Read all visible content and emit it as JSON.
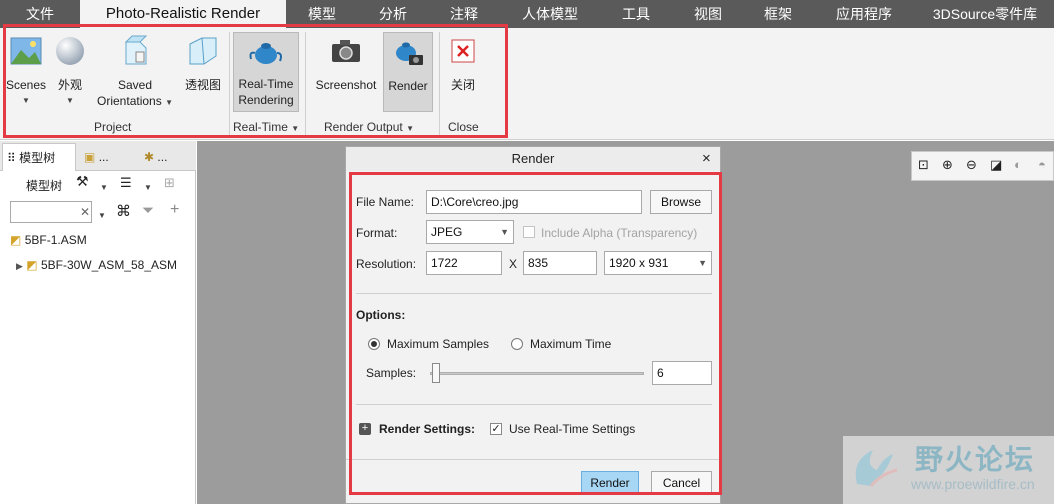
{
  "tabs": [
    "文件",
    "Photo-Realistic Render",
    "模型",
    "分析",
    "注释",
    "人体模型",
    "工具",
    "视图",
    "框架",
    "应用程序",
    "3DSource零件库"
  ],
  "ribbon": {
    "scenes": "Scenes",
    "appearance": "外观",
    "saved_orientations_line1": "Saved",
    "saved_orientations_line2": "Orientations",
    "perspective": "透视图",
    "realtime_line1": "Real-Time",
    "realtime_line2": "Rendering",
    "screenshot": "Screenshot",
    "render": "Render",
    "close": "关闭",
    "groups": {
      "project": "Project",
      "realtime": "Real-Time",
      "render_output": "Render Output",
      "close": "Close"
    }
  },
  "leftpanel": {
    "tabs": [
      "模型树",
      "...",
      "..."
    ],
    "toolbar_label": "模型树",
    "search_placeholder": "",
    "tree": [
      {
        "label": "5BF-1.ASM"
      },
      {
        "label": "5BF-30W_ASM_58_ASM"
      }
    ]
  },
  "dialog": {
    "title": "Render",
    "close_glyph": "×",
    "file_name_label": "File Name:",
    "file_name_value": "D:\\Core\\creo.jpg",
    "browse": "Browse",
    "format_label": "Format:",
    "format_value": "JPEG",
    "include_alpha": "Include Alpha (Transparency)",
    "resolution_label": "Resolution:",
    "res_w": "1722",
    "res_x": "X",
    "res_h": "835",
    "res_preset": "1920 x 931",
    "options_label": "Options:",
    "max_samples": "Maximum Samples",
    "max_time": "Maximum Time",
    "samples_label": "Samples:",
    "samples_value": "6",
    "render_settings_label": "Render Settings:",
    "use_realtime": "Use Real-Time Settings",
    "render_button": "Render",
    "cancel_button": "Cancel"
  },
  "watermark": {
    "title": "野火论坛",
    "url": "www.proewildfire.cn"
  }
}
